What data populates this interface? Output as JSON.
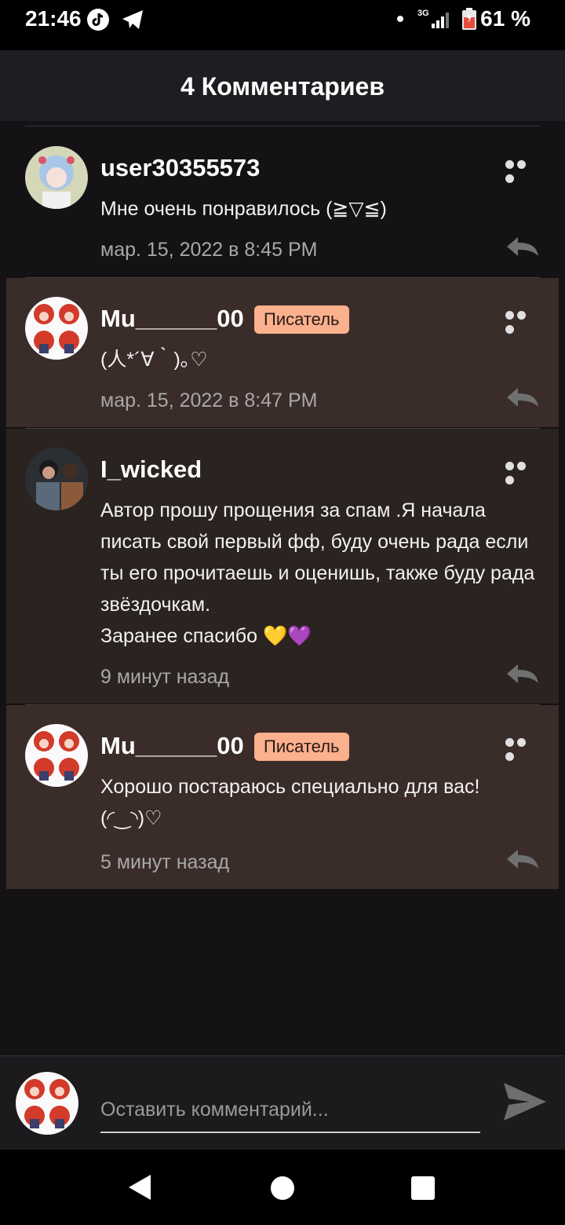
{
  "status_bar": {
    "time": "21:46",
    "network": "3G",
    "battery": "61 %"
  },
  "header": {
    "title": "4 Комментариев"
  },
  "comments": [
    {
      "username": "user30355573",
      "badge": "",
      "text": "Мне очень понравилось (≧▽≦)",
      "time": "мар. 15, 2022 в 8:45 PM"
    },
    {
      "username": "Mu______00",
      "badge": "Писатель",
      "text": "(人*´∀｀)｡♡",
      "time": "мар. 15, 2022 в 8:47 PM"
    },
    {
      "username": "I_wicked",
      "badge": "",
      "text": "Автор прошу прощения за спам .Я начала писать свой первый фф, буду очень рада если ты его прочитаешь и оценишь, также буду рада звёздочкам.\nЗаранее спасибо 💛💜",
      "time": "9 минут назад"
    },
    {
      "username": "Mu______00",
      "badge": "Писатель",
      "text": "Хорошо постараюсь специально для вас!\n(◜‿◝)♡",
      "time": "5 минут назад"
    }
  ],
  "comment_input": {
    "placeholder": "Оставить комментарий..."
  },
  "colors": {
    "badge_bg": "#fbb08e",
    "highlight_bg": "#3a2c29",
    "background": "#141215"
  },
  "icons": [
    "tiktok-icon",
    "telegram-icon",
    "signal-icon",
    "battery-icon",
    "more-icon",
    "reply-icon",
    "send-icon",
    "back-icon",
    "home-icon",
    "recents-icon"
  ]
}
